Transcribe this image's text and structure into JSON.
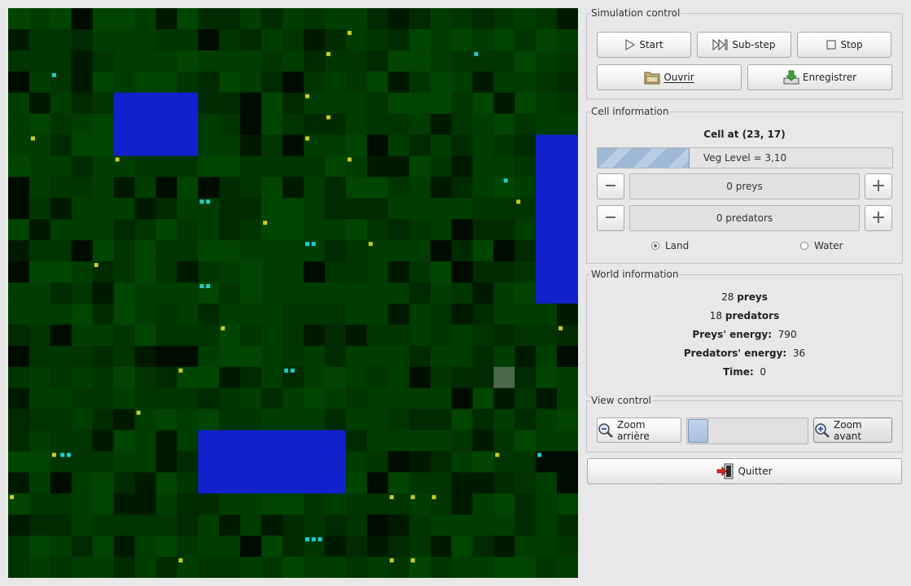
{
  "world": {
    "cols": 27,
    "rows": 27,
    "colors": {
      "veg": [
        "#003500",
        "#003d00",
        "#004500",
        "#002a00",
        "#001a00",
        "#000c00"
      ],
      "water": "#1122cc",
      "selected": "#4a6a4a",
      "prey": "#22cccc",
      "predator": "#cccc22"
    },
    "water_cells": [
      [
        5,
        4,
        4,
        3
      ],
      [
        25,
        6,
        2,
        8
      ],
      [
        9,
        20,
        7,
        3
      ]
    ],
    "selected_cell": [
      23,
      17
    ],
    "preys": [
      [
        2,
        3
      ],
      [
        22,
        2
      ],
      [
        9,
        9
      ],
      [
        9.3,
        9
      ],
      [
        14,
        11
      ],
      [
        14.3,
        11
      ],
      [
        9,
        13
      ],
      [
        9.3,
        13
      ],
      [
        13,
        17
      ],
      [
        13.3,
        17
      ],
      [
        2.4,
        21
      ],
      [
        2.7,
        21
      ],
      [
        23.4,
        8
      ],
      [
        25,
        21
      ],
      [
        14,
        25
      ],
      [
        14.3,
        25
      ],
      [
        14.6,
        25
      ]
    ],
    "predators": [
      [
        16,
        1
      ],
      [
        15,
        2
      ],
      [
        14,
        4
      ],
      [
        15,
        5
      ],
      [
        14,
        6
      ],
      [
        1,
        6
      ],
      [
        5,
        7
      ],
      [
        16,
        7
      ],
      [
        24,
        9
      ],
      [
        12,
        10
      ],
      [
        17,
        11
      ],
      [
        4,
        12
      ],
      [
        10,
        15
      ],
      [
        26,
        15
      ],
      [
        8,
        17
      ],
      [
        6,
        19
      ],
      [
        2,
        21
      ],
      [
        23,
        21
      ],
      [
        0,
        23
      ],
      [
        18,
        23
      ],
      [
        19,
        23
      ],
      [
        20,
        23
      ],
      [
        14,
        25
      ],
      [
        8,
        26
      ],
      [
        18,
        26
      ],
      [
        19,
        26
      ]
    ]
  },
  "simulation_control": {
    "title": "Simulation control",
    "start": "Start",
    "substep": "Sub-step",
    "stop": "Stop",
    "open": "Ouvrir",
    "save": "Enregistrer"
  },
  "cell_info": {
    "title": "Cell information",
    "cell_at": "Cell at (23, 17)",
    "veg_level_text": "Veg Level = 3,10",
    "veg_level_fraction": 0.31,
    "preys": "0 preys",
    "predators": "0 predators",
    "land": "Land",
    "water": "Water",
    "selected_type": "Land"
  },
  "world_info": {
    "title": "World information",
    "preys_count": "28",
    "preys_label": "preys",
    "predators_count": "18",
    "predators_label": "predators",
    "preys_energy_label": "Preys' energy:",
    "preys_energy": "790",
    "predators_energy_label": "Predators' energy:",
    "predators_energy": "36",
    "time_label": "Time:",
    "time": "0"
  },
  "view_control": {
    "title": "View control",
    "zoom_out": "Zoom arrière",
    "zoom_in": "Zoom avant",
    "zoom_level": 0.0
  },
  "quit": "Quitter"
}
